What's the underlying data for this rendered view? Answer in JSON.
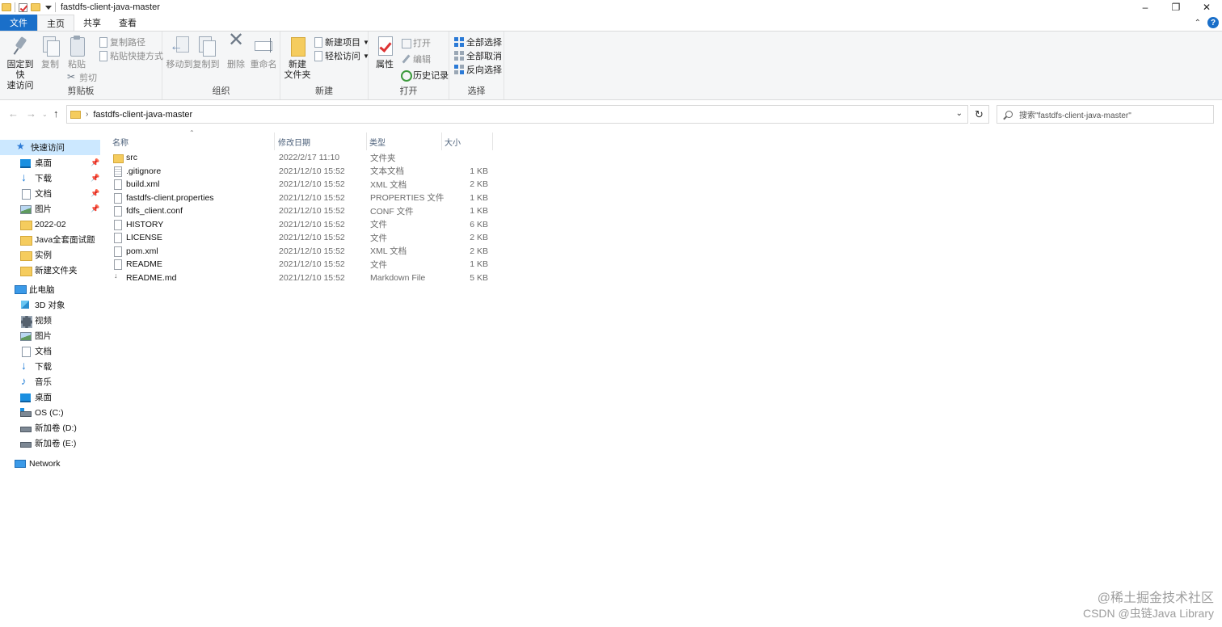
{
  "window": {
    "title": "fastdfs-client-java-master",
    "minimize_glyph": "–",
    "restore_glyph": "❐",
    "close_glyph": "✕"
  },
  "ribbon_tabs": [
    "文件",
    "主页",
    "共享",
    "查看"
  ],
  "ribbon": {
    "clipboard": {
      "label": "剪贴板",
      "pin_line1": "固定到快",
      "pin_line2": "速访问",
      "copy": "复制",
      "paste": "粘贴",
      "copy_path": "复制路径",
      "paste_shortcut": "粘贴快捷方式",
      "cut": "剪切"
    },
    "organize": {
      "label": "组织",
      "move_to": "移动到",
      "copy_to": "复制到",
      "delete": "删除",
      "rename": "重命名"
    },
    "new": {
      "label": "新建",
      "new_folder_line1": "新建",
      "new_folder_line2": "文件夹",
      "new_item": "新建项目",
      "easy_access": "轻松访问"
    },
    "open": {
      "label": "打开",
      "properties": "属性",
      "open": "打开",
      "edit": "编辑",
      "history": "历史记录"
    },
    "select": {
      "label": "选择",
      "select_all": "全部选择",
      "select_none": "全部取消",
      "invert": "反向选择"
    }
  },
  "address": {
    "path": "fastdfs-client-java-master",
    "search_placeholder": "搜索\"fastdfs-client-java-master\""
  },
  "nav": {
    "quick_access": "快速访问",
    "quick_items": [
      "桌面",
      "下载",
      "文档",
      "图片",
      "2022-02",
      "Java全套面试题",
      "实例",
      "新建文件夹"
    ],
    "this_pc": "此电脑",
    "pc_items": [
      "3D 对象",
      "视频",
      "图片",
      "文档",
      "下载",
      "音乐",
      "桌面",
      "OS (C:)",
      "新加卷 (D:)",
      "新加卷 (E:)"
    ],
    "network": "Network"
  },
  "columns": {
    "name": "名称",
    "date": "修改日期",
    "type": "类型",
    "size": "大小"
  },
  "files": [
    {
      "name": "src",
      "date": "2022/2/17 11:10",
      "type": "文件夹",
      "size": "",
      "icon": "folder-icon"
    },
    {
      "name": ".gitignore",
      "date": "2021/12/10 15:52",
      "type": "文本文档",
      "size": "1 KB",
      "icon": "text-file-icon"
    },
    {
      "name": "build.xml",
      "date": "2021/12/10 15:52",
      "type": "XML 文档",
      "size": "2 KB",
      "icon": "file-icon"
    },
    {
      "name": "fastdfs-client.properties",
      "date": "2021/12/10 15:52",
      "type": "PROPERTIES 文件",
      "size": "1 KB",
      "icon": "file-icon"
    },
    {
      "name": "fdfs_client.conf",
      "date": "2021/12/10 15:52",
      "type": "CONF 文件",
      "size": "1 KB",
      "icon": "file-icon"
    },
    {
      "name": "HISTORY",
      "date": "2021/12/10 15:52",
      "type": "文件",
      "size": "6 KB",
      "icon": "file-icon"
    },
    {
      "name": "LICENSE",
      "date": "2021/12/10 15:52",
      "type": "文件",
      "size": "2 KB",
      "icon": "file-icon"
    },
    {
      "name": "pom.xml",
      "date": "2021/12/10 15:52",
      "type": "XML 文档",
      "size": "2 KB",
      "icon": "file-icon"
    },
    {
      "name": "README",
      "date": "2021/12/10 15:52",
      "type": "文件",
      "size": "1 KB",
      "icon": "file-icon"
    },
    {
      "name": "README.md",
      "date": "2021/12/10 15:52",
      "type": "Markdown File",
      "size": "5 KB",
      "icon": "markdown-file-icon"
    }
  ],
  "watermark": {
    "line1": "@稀土掘金技术社区",
    "line2": "CSDN @虫链Java Library"
  }
}
